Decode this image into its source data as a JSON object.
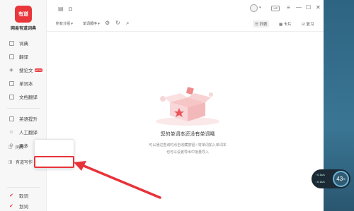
{
  "app": {
    "logo_text": "有道",
    "name": "网易有道词典"
  },
  "sidebar": {
    "items": [
      {
        "label": "词典",
        "icon": "dictionary-icon"
      },
      {
        "label": "翻译",
        "icon": "translate-icon"
      },
      {
        "label": "搜论文",
        "icon": "paper-search-icon",
        "badge": "NEW"
      },
      {
        "label": "单词本",
        "icon": "wordbook-icon"
      },
      {
        "label": "文档翻译",
        "icon": "document-icon"
      },
      {
        "label": "英语提升",
        "icon": "chart-icon"
      },
      {
        "label": "人工翻译",
        "icon": "person-icon"
      },
      {
        "label": "更多",
        "icon": "more-icon"
      }
    ],
    "bottom": [
      {
        "label": "取词",
        "icon": "checkbox-checked-icon"
      },
      {
        "label": "划词",
        "icon": "checkbox-checked-icon"
      }
    ]
  },
  "topbar": {
    "vip_label": "VIP"
  },
  "toolbar": {
    "filter_group": "所有分组",
    "filter_sort": "单词顺序",
    "view_list": "列表",
    "view_card": "卡片",
    "view_review": "复习"
  },
  "empty": {
    "title": "您的单词本还没有单词哦",
    "desc1": "可以通过查询时点击收藏按钮☆将单词加入单词本",
    "desc2": "也可以设置导出中批量导入"
  },
  "popup": {
    "item1": "同传",
    "item2": "有道写作"
  },
  "widget": {
    "row1": "0.1k/s",
    "row2": "0.1k/s",
    "percent": "43",
    "percent_unit": "%"
  },
  "colors": {
    "brand": "#e8363b",
    "annotation": "#e8323a"
  }
}
